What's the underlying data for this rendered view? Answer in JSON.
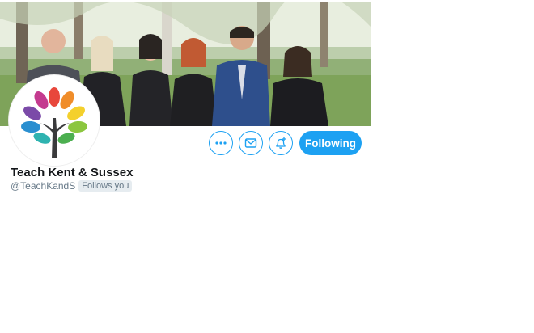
{
  "profile": {
    "display_name": "Teach Kent & Sussex",
    "handle": "@TeachKandS",
    "follows_you_label": "Follows you",
    "follow_button_label": "Following"
  },
  "icons": {
    "more": "more-horizontal-icon",
    "message": "envelope-icon",
    "notify": "bell-plus-icon"
  },
  "colors": {
    "accent": "#1da1f2",
    "name_text": "#14171a",
    "secondary_text": "#657786",
    "badge_bg": "#e6ecf0"
  }
}
